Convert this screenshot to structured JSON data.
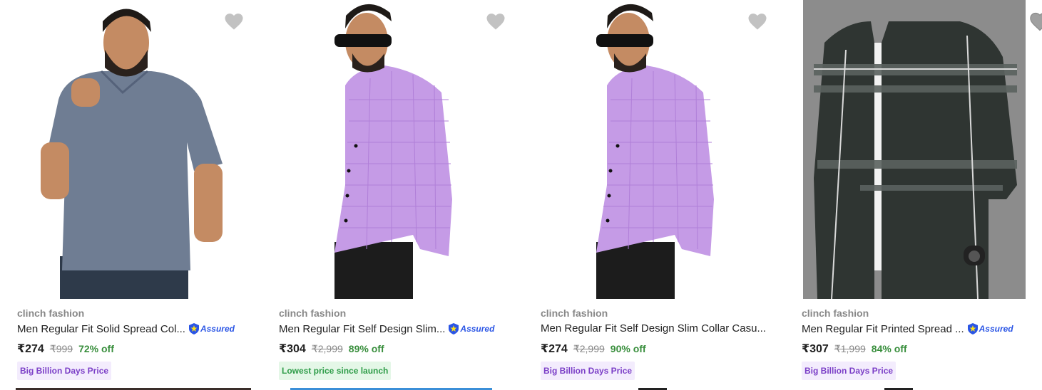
{
  "products": [
    {
      "brand": "clinch fashion",
      "title": "Men Regular Fit Solid Spread Col...",
      "assured": "Assured",
      "price": "₹274",
      "mrp": "₹999",
      "discount": "72% off",
      "badge": "Big Billion Days Price",
      "shirt_color": "#6f7d93"
    },
    {
      "brand": "clinch fashion",
      "title": "Men Regular Fit Self Design Slim...",
      "assured": "Assured",
      "price": "₹304",
      "mrp": "₹2,999",
      "discount": "89% off",
      "badge": "Lowest price since launch",
      "shirt_color": "#c59be6"
    },
    {
      "brand": "clinch fashion",
      "title": "Men Regular Fit Self Design Slim Collar Casu...",
      "assured": "",
      "price": "₹274",
      "mrp": "₹2,999",
      "discount": "90% off",
      "badge": "Big Billion Days Price",
      "shirt_color": "#c59be6"
    },
    {
      "brand": "clinch fashion",
      "title": "Men Regular Fit Printed Spread ...",
      "assured": "Assured",
      "price": "₹307",
      "mrp": "₹1,999",
      "discount": "84% off",
      "badge": "Big Billion Days Price",
      "shirt_color": "#2f3532"
    }
  ],
  "icons": {
    "wishlist": "heart-icon",
    "assured": "shield-icon"
  },
  "colors": {
    "discount": "#388e3c",
    "assured": "#2a55e5",
    "badge_purple": "#7b3fc7",
    "badge_green": "#2e9c48"
  }
}
